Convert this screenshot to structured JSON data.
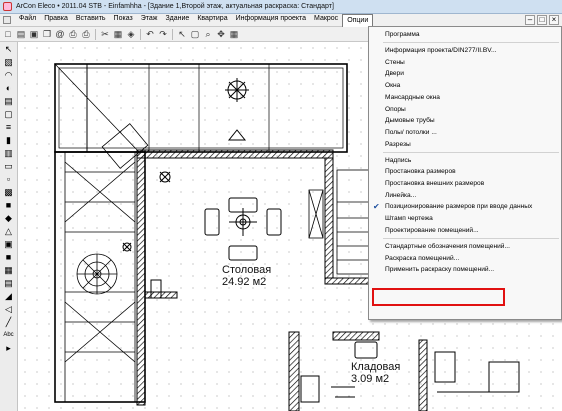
{
  "window": {
    "title": "ArCon Eleco  • 2011.04  STB - Einfamhha - [Здание 1,Второй этаж, актуальная раскраска: Стандарт]"
  },
  "menubar": {
    "items": [
      "Файл",
      "Правка",
      "Вставить",
      "Показ",
      "Этаж",
      "Здание",
      "Квартира",
      "Информация проекта",
      "Макрос",
      "Опции"
    ],
    "active": "Опции",
    "controls": [
      "–",
      "□",
      "×"
    ]
  },
  "toolbar": {
    "icons": [
      "new-icon",
      "open-icon",
      "save-icon",
      "copy-icon",
      "email-icon",
      "print-icon",
      "printer-icon",
      "cut-icon",
      "paste-icon",
      "group-icon",
      "undo-icon",
      "redo-icon",
      "pointer-icon",
      "select-icon",
      "zoom-icon",
      "pan-icon",
      "grid-icon"
    ],
    "glyphs": [
      "□",
      "▤",
      "▣",
      "❐",
      "@",
      "⎙",
      "⎙",
      "✂",
      "▦",
      "◈",
      "↶",
      "↷",
      "↖",
      "▢",
      "⌕",
      "✥",
      "▦"
    ]
  },
  "left_tools": {
    "icons": [
      "pointer-tool-icon",
      "wall-tool-icon",
      "roof-tool-icon",
      "door-tool-icon",
      "window-tool-icon",
      "room-tool-icon",
      "stairs-tool-icon",
      "support-tool-icon",
      "chimney-tool-icon",
      "floor-tool-icon",
      "ceiling-tool-icon",
      "section-tool-icon",
      "furniture-tool-icon",
      "object-tool-icon",
      "symbol-tool-icon",
      "fill-tool-icon",
      "color-tool-icon",
      "material-tool-icon",
      "text-tool-icon",
      "dimension-tool-icon",
      "line-tool-icon",
      "measure-tool-icon",
      "abc-tool-icon",
      "settings-tool-icon"
    ],
    "glyphs": [
      "↖",
      "▧",
      "◠",
      "◐",
      "▤",
      "▢",
      "≡",
      "▮",
      "▥",
      "▭",
      "▫",
      "▩",
      "■",
      "◆",
      "△",
      "▣",
      "■",
      "▦",
      "▤",
      "◢",
      "◁",
      "╱",
      "Abc",
      "▸"
    ]
  },
  "canvas": {
    "rooms": [
      {
        "name": "Столовая",
        "area": "24.92 м2"
      },
      {
        "name": "Кладовая",
        "area": "3.09 м2"
      }
    ]
  },
  "options_menu": {
    "items": [
      {
        "label": "Программа"
      },
      {
        "separator": true
      },
      {
        "label": "Информация проекта/DIN277/II.BV..."
      },
      {
        "label": "Стены"
      },
      {
        "label": "Двери"
      },
      {
        "label": "Окна"
      },
      {
        "label": "Мансардные окна"
      },
      {
        "label": "Опоры"
      },
      {
        "label": "Дымовые трубы"
      },
      {
        "label": "Полы/ потолки ..."
      },
      {
        "label": "Разрезы"
      },
      {
        "separator": true
      },
      {
        "label": "Надпись"
      },
      {
        "label": "Простановка размеров"
      },
      {
        "label": "Простановка внешних размеров"
      },
      {
        "label": "Линейка..."
      },
      {
        "label": "Позиционирование размеров при вводе данных",
        "checked": true
      },
      {
        "label": "Штамп чертежа"
      },
      {
        "label": "Проектирование помещений..."
      },
      {
        "separator": true
      },
      {
        "label": "Стандартные обозначения помещений..."
      },
      {
        "label": "Раскраска помещений...",
        "highlighted": true
      },
      {
        "label": "Применить раскраску помещений..."
      }
    ],
    "highlight_color": "#e11111"
  }
}
